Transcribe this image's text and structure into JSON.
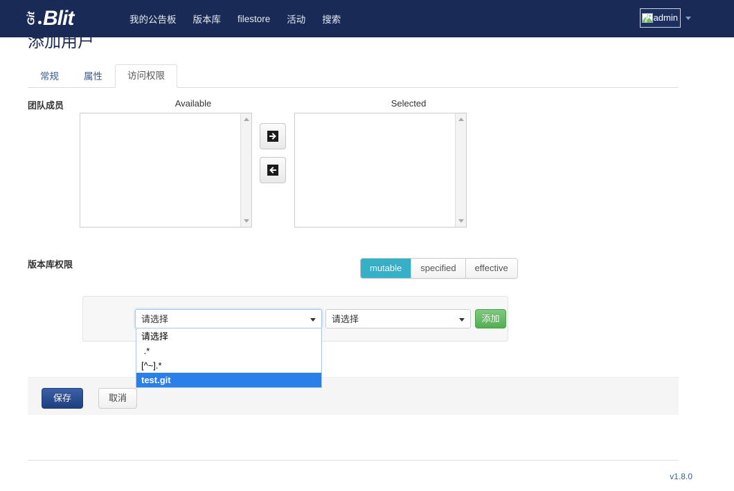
{
  "navbar": {
    "brand": {
      "git": "Git",
      "blit": "Blit"
    },
    "links": [
      {
        "label": "我的公告板",
        "name": "nav-link-dashboard"
      },
      {
        "label": "版本库",
        "name": "nav-link-repositories"
      },
      {
        "label": "filestore",
        "name": "nav-link-filestore"
      },
      {
        "label": "活动",
        "name": "nav-link-activity"
      },
      {
        "label": "搜索",
        "name": "nav-link-search"
      }
    ],
    "user": {
      "name": "admin",
      "avatar_icon": "broken-image-icon",
      "caret_icon": "chevron-down-icon"
    }
  },
  "page": {
    "title": "添加用户",
    "tabs": [
      {
        "label": "常规",
        "active": false
      },
      {
        "label": "属性",
        "active": false
      },
      {
        "label": "访问权限",
        "active": true
      }
    ]
  },
  "team": {
    "label": "团队成员",
    "available_heading": "Available",
    "selected_heading": "Selected",
    "available_items": [],
    "selected_items": [],
    "add_button_icon": "arrow-right-into-box-icon",
    "remove_button_icon": "arrow-left-into-box-icon"
  },
  "permissions": {
    "label": "版本库权限",
    "segments": [
      {
        "label": "mutable",
        "active": true
      },
      {
        "label": "specified",
        "active": false
      },
      {
        "label": "effective",
        "active": false
      }
    ],
    "active_segment_color": "#36b0c9",
    "repo_select": {
      "value": "请选择",
      "open": true,
      "options": [
        "请选择",
        " .*",
        "[^~].*",
        "test.git"
      ],
      "highlighted_option": "test.git",
      "highlight_color": "#2a7fe8"
    },
    "perm_select": {
      "value": "请选择"
    },
    "add_label": "添加"
  },
  "actions": {
    "save_label": "保存",
    "cancel_label": "取消"
  },
  "footer": {
    "version": "v1.8.0"
  }
}
